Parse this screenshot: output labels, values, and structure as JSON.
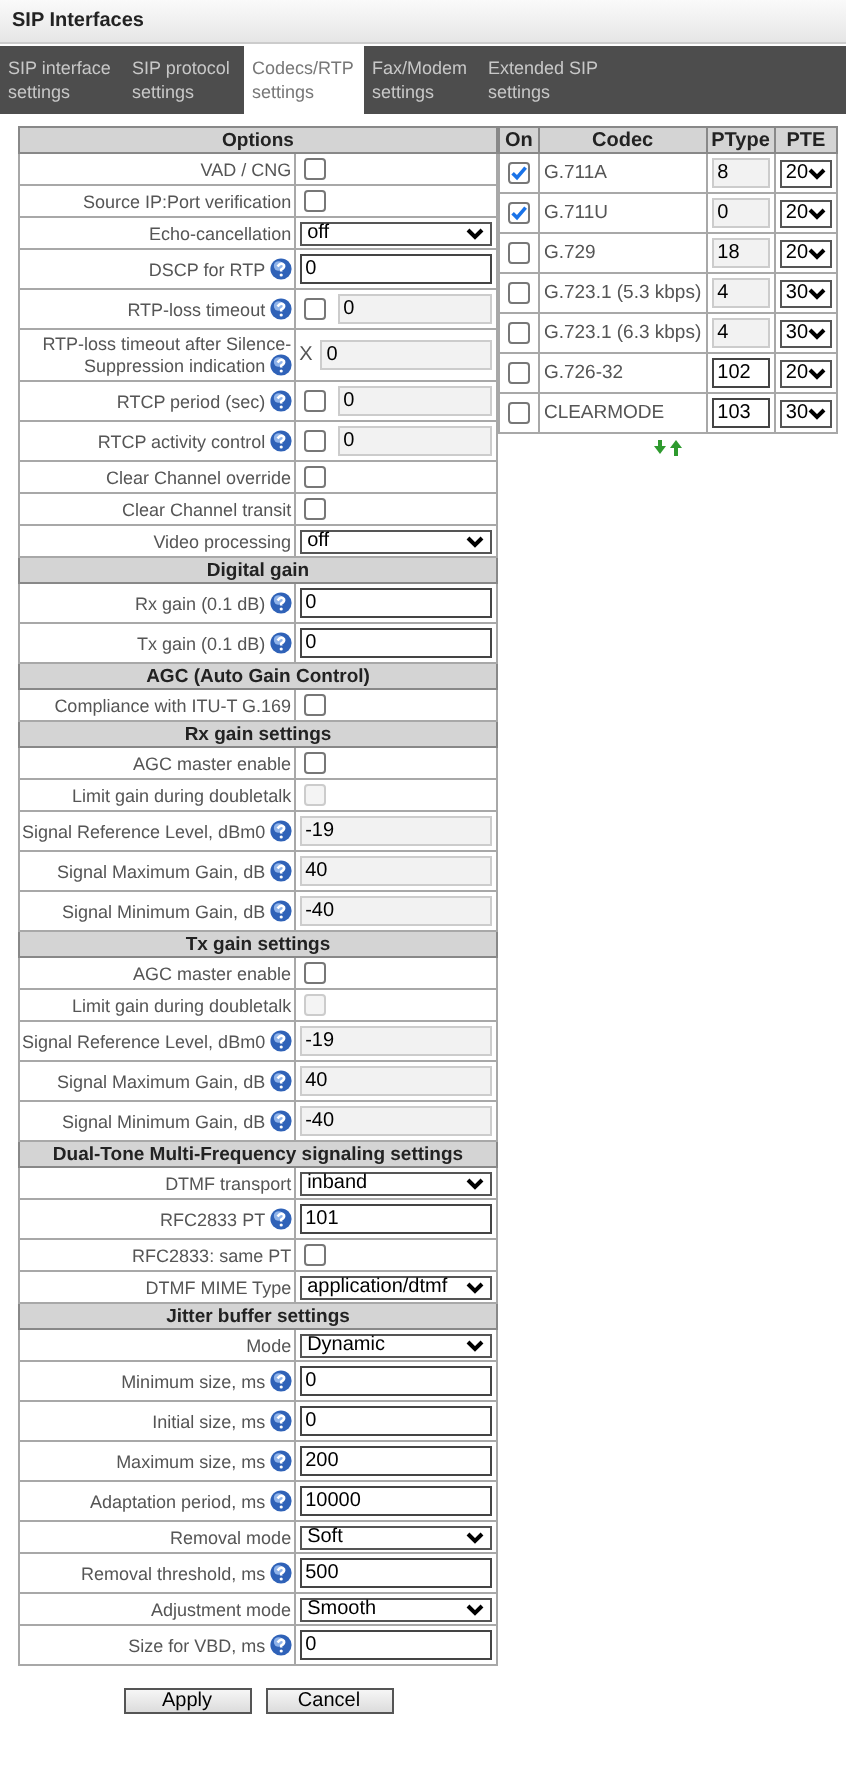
{
  "header": {
    "title": "SIP Interfaces"
  },
  "tabs": [
    {
      "label": "SIP interface settings",
      "selected": false
    },
    {
      "label": "SIP protocol settings",
      "selected": false
    },
    {
      "label": "Codecs/RTP settings",
      "selected": true
    },
    {
      "label": "Fax/Modem settings",
      "selected": false
    },
    {
      "label": "Extended SIP settings",
      "selected": false
    }
  ],
  "sections": [
    {
      "title": "Options",
      "rows": [
        {
          "kind": "checkbox",
          "label": "VAD / CNG",
          "help": false,
          "checked": false,
          "disabled": false
        },
        {
          "kind": "checkbox",
          "label": "Source IP:Port verification",
          "help": false,
          "checked": false,
          "disabled": false
        },
        {
          "kind": "select",
          "label": "Echo-cancellation",
          "help": false,
          "value": "off"
        },
        {
          "kind": "input",
          "label": "DSCP for RTP",
          "help": true,
          "value": "0",
          "disabled": false
        },
        {
          "kind": "check_input",
          "label": "RTP-loss timeout",
          "help": true,
          "checked": false,
          "value": "0"
        },
        {
          "kind": "x_input",
          "label": "RTP-loss timeout after Silence-Suppression indication",
          "help": true,
          "prefix": "X",
          "value": "0"
        },
        {
          "kind": "check_input",
          "label": "RTCP period (sec)",
          "help": true,
          "checked": false,
          "value": "0"
        },
        {
          "kind": "check_input",
          "label": "RTCP activity control",
          "help": true,
          "checked": false,
          "value": "0"
        },
        {
          "kind": "checkbox",
          "label": "Clear Channel override",
          "help": false,
          "checked": false,
          "disabled": false
        },
        {
          "kind": "checkbox",
          "label": "Clear Channel transit",
          "help": false,
          "checked": false,
          "disabled": false
        },
        {
          "kind": "select",
          "label": "Video processing",
          "help": false,
          "value": "off"
        }
      ]
    },
    {
      "title": "Digital gain",
      "rows": [
        {
          "kind": "input",
          "label": "Rx gain (0.1 dB)",
          "help": true,
          "value": "0",
          "disabled": false
        },
        {
          "kind": "input",
          "label": "Tx gain (0.1 dB)",
          "help": true,
          "value": "0",
          "disabled": false
        }
      ]
    },
    {
      "title": "AGC (Auto Gain Control)",
      "rows": [
        {
          "kind": "checkbox",
          "label": "Compliance with ITU-T G.169",
          "help": false,
          "checked": false,
          "disabled": false
        }
      ]
    },
    {
      "title": "Rx gain settings",
      "rows": [
        {
          "kind": "checkbox",
          "label": "AGC master enable",
          "help": false,
          "checked": false,
          "disabled": false
        },
        {
          "kind": "checkbox",
          "label": "Limit gain during doubletalk",
          "help": false,
          "checked": false,
          "disabled": true
        },
        {
          "kind": "input",
          "label": "Signal Reference Level, dBm0",
          "help": true,
          "value": "-19",
          "disabled": true
        },
        {
          "kind": "input",
          "label": "Signal Maximum Gain, dB",
          "help": true,
          "value": "40",
          "disabled": true
        },
        {
          "kind": "input",
          "label": "Signal Minimum Gain, dB",
          "help": true,
          "value": "-40",
          "disabled": true
        }
      ]
    },
    {
      "title": "Tx gain settings",
      "rows": [
        {
          "kind": "checkbox",
          "label": "AGC master enable",
          "help": false,
          "checked": false,
          "disabled": false
        },
        {
          "kind": "checkbox",
          "label": "Limit gain during doubletalk",
          "help": false,
          "checked": false,
          "disabled": true
        },
        {
          "kind": "input",
          "label": "Signal Reference Level, dBm0",
          "help": true,
          "value": "-19",
          "disabled": true
        },
        {
          "kind": "input",
          "label": "Signal Maximum Gain, dB",
          "help": true,
          "value": "40",
          "disabled": true
        },
        {
          "kind": "input",
          "label": "Signal Minimum Gain, dB",
          "help": true,
          "value": "-40",
          "disabled": true
        }
      ]
    },
    {
      "title": "Dual-Tone Multi-Frequency signaling settings",
      "rows": [
        {
          "kind": "select",
          "label": "DTMF transport",
          "help": false,
          "value": "inband"
        },
        {
          "kind": "input",
          "label": "RFC2833 PT",
          "help": true,
          "value": "101",
          "disabled": false
        },
        {
          "kind": "checkbox",
          "label": "RFC2833: same PT",
          "help": false,
          "checked": false,
          "disabled": false
        },
        {
          "kind": "select",
          "label": "DTMF MIME Type",
          "help": false,
          "value": "application/dtmf"
        }
      ]
    },
    {
      "title": "Jitter buffer settings",
      "rows": [
        {
          "kind": "select",
          "label": "Mode",
          "help": false,
          "value": "Dynamic"
        },
        {
          "kind": "input",
          "label": "Minimum size, ms",
          "help": true,
          "value": "0",
          "disabled": false
        },
        {
          "kind": "input",
          "label": "Initial size, ms",
          "help": true,
          "value": "0",
          "disabled": false
        },
        {
          "kind": "input",
          "label": "Maximum size, ms",
          "help": true,
          "value": "200",
          "disabled": false
        },
        {
          "kind": "input",
          "label": "Adaptation period, ms",
          "help": true,
          "value": "10000",
          "disabled": false
        },
        {
          "kind": "select",
          "label": "Removal mode",
          "help": false,
          "value": "Soft"
        },
        {
          "kind": "input",
          "label": "Removal threshold, ms",
          "help": true,
          "value": "500",
          "disabled": false
        },
        {
          "kind": "select",
          "label": "Adjustment mode",
          "help": false,
          "value": "Smooth"
        },
        {
          "kind": "input",
          "label": "Size for VBD, ms",
          "help": true,
          "value": "0",
          "disabled": false
        }
      ]
    }
  ],
  "codecs": {
    "columns": [
      "On",
      "Codec",
      "PType",
      "PTE"
    ],
    "rows": [
      {
        "on": true,
        "codec": "G.711A",
        "ptype": "8",
        "ptype_disabled": true,
        "pte": "20"
      },
      {
        "on": true,
        "codec": "G.711U",
        "ptype": "0",
        "ptype_disabled": true,
        "pte": "20"
      },
      {
        "on": false,
        "codec": "G.729",
        "ptype": "18",
        "ptype_disabled": true,
        "pte": "20"
      },
      {
        "on": false,
        "codec": "G.723.1 (5.3 kbps)",
        "ptype": "4",
        "ptype_disabled": true,
        "pte": "30"
      },
      {
        "on": false,
        "codec": "G.723.1 (6.3 kbps)",
        "ptype": "4",
        "ptype_disabled": true,
        "pte": "30"
      },
      {
        "on": false,
        "codec": "G.726-32",
        "ptype": "102",
        "ptype_disabled": false,
        "pte": "20"
      },
      {
        "on": false,
        "codec": "CLEARMODE",
        "ptype": "103",
        "ptype_disabled": false,
        "pte": "30"
      }
    ]
  },
  "buttons": [
    "Apply",
    "Cancel"
  ]
}
